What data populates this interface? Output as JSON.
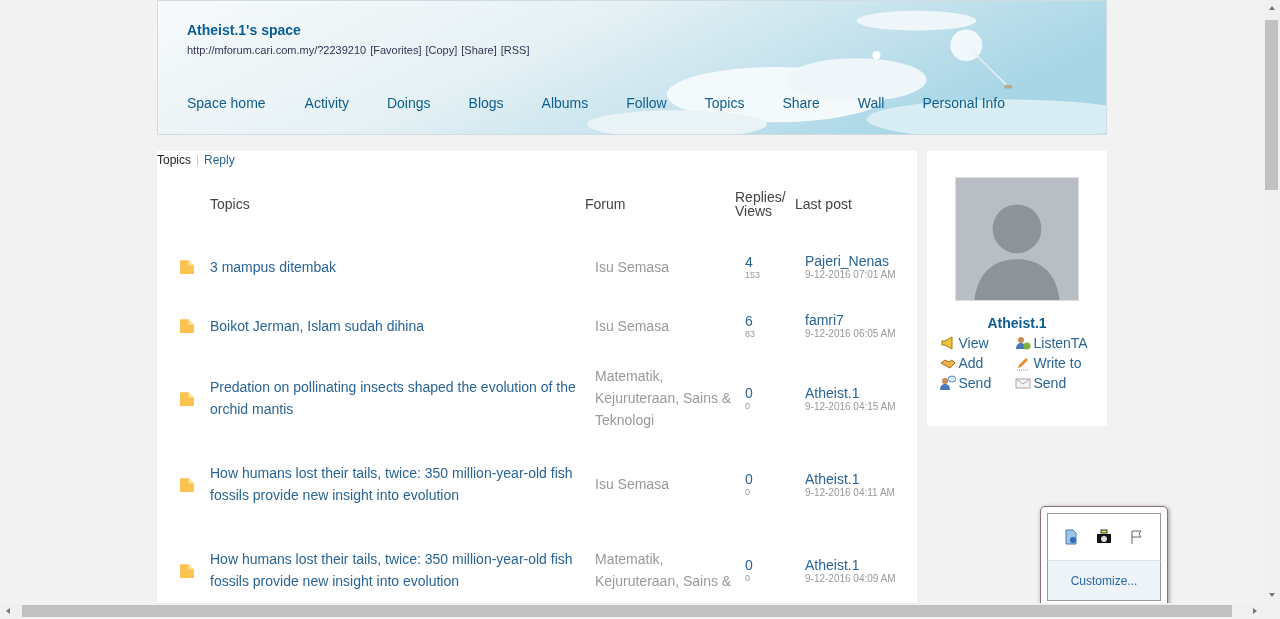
{
  "header": {
    "title": "Atheist.1's space",
    "url": "http://mforum.cari.com.my/?2239210",
    "links": [
      "[Favorites]",
      "[Copy]",
      "[Share]",
      "[RSS]"
    ],
    "nav": [
      {
        "label": "Space home"
      },
      {
        "label": "Activity"
      },
      {
        "label": "Doings"
      },
      {
        "label": "Blogs"
      },
      {
        "label": "Albums"
      },
      {
        "label": "Follow"
      },
      {
        "label": "Topics"
      },
      {
        "label": "Share"
      },
      {
        "label": "Wall"
      },
      {
        "label": "Personal Info"
      }
    ]
  },
  "tabs": [
    {
      "label": "Topics",
      "selected": true
    },
    {
      "label": "Reply",
      "selected": false
    }
  ],
  "table": {
    "columns": [
      "Topics",
      "Forum",
      "Replies/Views",
      "Last post"
    ],
    "rows": [
      {
        "topic": "3 mampus ditembak",
        "forum": "Isu Semasa",
        "replies": "4",
        "views": "153",
        "last_user": "Pajeri_Nenas",
        "last_time": "9-12-2016 07:01 AM"
      },
      {
        "topic": "Boikot Jerman, Islam sudah dihina",
        "forum": "Isu Semasa",
        "replies": "6",
        "views": "83",
        "last_user": "famri7",
        "last_time": "9-12-2016 06:05 AM"
      },
      {
        "topic": "Predation on pollinating insects shaped the evolution of the orchid mantis",
        "forum": "Matematik, Kejuruteraan, Sains & Teknologi",
        "replies": "0",
        "views": "0",
        "last_user": "Atheist.1",
        "last_time": "9-12-2016 04:15 AM"
      },
      {
        "topic": "How humans lost their tails, twice: 350 million-year-old fish fossils provide new insight into evolution",
        "forum": "Isu Semasa",
        "replies": "0",
        "views": "0",
        "last_user": "Atheist.1",
        "last_time": "9-12-2016 04:11 AM"
      },
      {
        "topic": "How humans lost their tails, twice: 350 million-year-old fish fossils provide new insight into evolution",
        "forum": "Matematik, Kejuruteraan, Sains &",
        "replies": "0",
        "views": "0",
        "last_user": "Atheist.1",
        "last_time": "9-12-2016 04:09 AM"
      }
    ]
  },
  "profile": {
    "name": "Atheist.1",
    "actions": [
      {
        "label": "View",
        "kind": "megaphone"
      },
      {
        "label": "ListenTA",
        "kind": "follow"
      },
      {
        "label": "Add",
        "kind": "handshake"
      },
      {
        "label": "Write to",
        "kind": "pencil"
      },
      {
        "label": "Send",
        "kind": "chat"
      },
      {
        "label": "Send",
        "kind": "mail"
      }
    ]
  },
  "tray": {
    "customize": "Customize..."
  }
}
